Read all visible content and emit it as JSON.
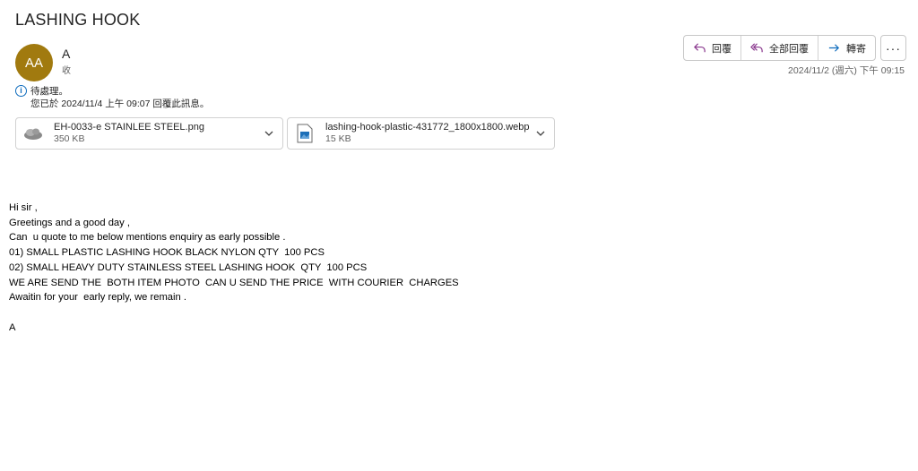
{
  "subject": "LASHING HOOK",
  "sender": {
    "initials": "AA",
    "name": "A",
    "recipient_label": "收"
  },
  "actions": {
    "reply": "回覆",
    "reply_all": "全部回覆",
    "forward": "轉寄",
    "more": "···"
  },
  "date": "2024/11/2 (週六) 下午 09:15",
  "info": {
    "line1": "待處理。",
    "line2": "您已於 2024/11/4 上午 09:07 回覆此訊息。"
  },
  "attachments": [
    {
      "name": "EH-0033-e STAINLEE STEEL.png",
      "size": "350 KB",
      "icon": "image-file-icon"
    },
    {
      "name": "lashing-hook-plastic-431772_1800x1800.webp",
      "size": "15 KB",
      "icon": "image-file-icon"
    }
  ],
  "body": {
    "lines": [
      "Hi sir ,",
      "Greetings and a good day ,",
      "Can  u quote to me below mentions enquiry as early possible .",
      "01) SMALL PLASTIC LASHING HOOK BLACK NYLON QTY  100 PCS",
      "02) SMALL HEAVY DUTY STAINLESS STEEL LASHING HOOK  QTY  100 PCS",
      "WE ARE SEND THE  BOTH ITEM PHOTO  CAN U SEND THE PRICE  WITH COURIER  CHARGES",
      "Awaitin for your  early reply, we remain .",
      "",
      "A"
    ]
  },
  "colors": {
    "avatar": "#a17a0f",
    "accent": "#0f6cbd",
    "reply_icon": "#8b3a8f"
  }
}
